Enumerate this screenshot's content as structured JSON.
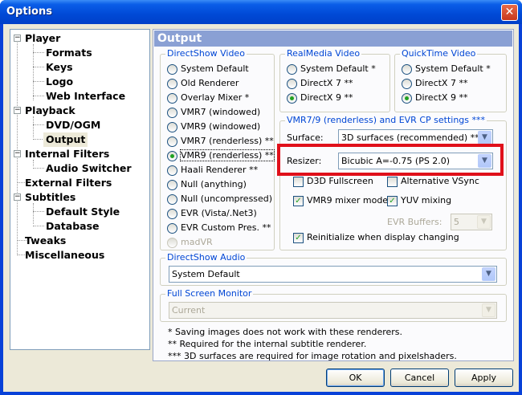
{
  "window": {
    "title": "Options",
    "close_glyph": "✕"
  },
  "tree": {
    "expander": "−",
    "items": [
      {
        "label": "Player"
      },
      {
        "label": "Formats"
      },
      {
        "label": "Keys"
      },
      {
        "label": "Logo"
      },
      {
        "label": "Web Interface"
      },
      {
        "label": "Playback"
      },
      {
        "label": "DVD/OGM"
      },
      {
        "label": "Output"
      },
      {
        "label": "Internal Filters"
      },
      {
        "label": "Audio Switcher"
      },
      {
        "label": "External Filters"
      },
      {
        "label": "Subtitles"
      },
      {
        "label": "Default Style"
      },
      {
        "label": "Database"
      },
      {
        "label": "Tweaks"
      },
      {
        "label": "Miscellaneous"
      }
    ],
    "selected": "Output"
  },
  "panel": {
    "title": "Output"
  },
  "directshow_video": {
    "caption": "DirectShow Video",
    "options": [
      {
        "label": "System Default",
        "checked": false
      },
      {
        "label": "Old Renderer",
        "checked": false
      },
      {
        "label": "Overlay Mixer *",
        "checked": false
      },
      {
        "label": "VMR7 (windowed)",
        "checked": false
      },
      {
        "label": "VMR9 (windowed)",
        "checked": false
      },
      {
        "label": "VMR7 (renderless) **",
        "checked": false
      },
      {
        "label": "VMR9 (renderless) **",
        "checked": true
      },
      {
        "label": "Haali Renderer **",
        "checked": false
      },
      {
        "label": "Null (anything)",
        "checked": false
      },
      {
        "label": "Null (uncompressed)",
        "checked": false
      },
      {
        "label": "EVR (Vista/.Net3)",
        "checked": false
      },
      {
        "label": "EVR Custom Pres. **",
        "checked": false
      },
      {
        "label": "madVR",
        "checked": false,
        "disabled": true
      }
    ]
  },
  "realmedia_video": {
    "caption": "RealMedia Video",
    "options": [
      {
        "label": "System Default *",
        "checked": false
      },
      {
        "label": "DirectX 7 **",
        "checked": false
      },
      {
        "label": "DirectX 9 **",
        "checked": true
      }
    ]
  },
  "quicktime_video": {
    "caption": "QuickTime Video",
    "options": [
      {
        "label": "System Default *",
        "checked": false
      },
      {
        "label": "DirectX 7 **",
        "checked": false
      },
      {
        "label": "DirectX 9 **",
        "checked": true
      }
    ]
  },
  "vmr_settings": {
    "caption": "VMR7/9 (renderless) and EVR CP settings ***",
    "surface_label": "Surface:",
    "surface_value": "3D surfaces (recommended) ***",
    "resizer_label": "Resizer:",
    "resizer_value": "Bicubic A=-0.75 (PS 2.0)",
    "d3d_fullscreen": "D3D Fullscreen",
    "alt_vsync": "Alternative VSync",
    "vmr9_mixer": "VMR9 mixer mode",
    "yuv_mixing": "YUV mixing",
    "evr_buffers_label": "EVR Buffers:",
    "evr_buffers_value": "5",
    "reinit": "Reinitialize when display changing",
    "check_glyph": "✓",
    "highlight_color": "#e0101a"
  },
  "directshow_audio": {
    "caption": "DirectShow Audio",
    "value": "System Default"
  },
  "fullscreen_monitor": {
    "caption": "Full Screen Monitor",
    "value": "Current"
  },
  "notes": [
    "* Saving images does not work with these renderers.",
    "** Required for the internal subtitle renderer.",
    "*** 3D surfaces are required for image rotation and pixelshaders."
  ],
  "buttons": {
    "ok": "OK",
    "cancel": "Cancel",
    "apply": "Apply"
  },
  "dropdown_glyph": "▼"
}
